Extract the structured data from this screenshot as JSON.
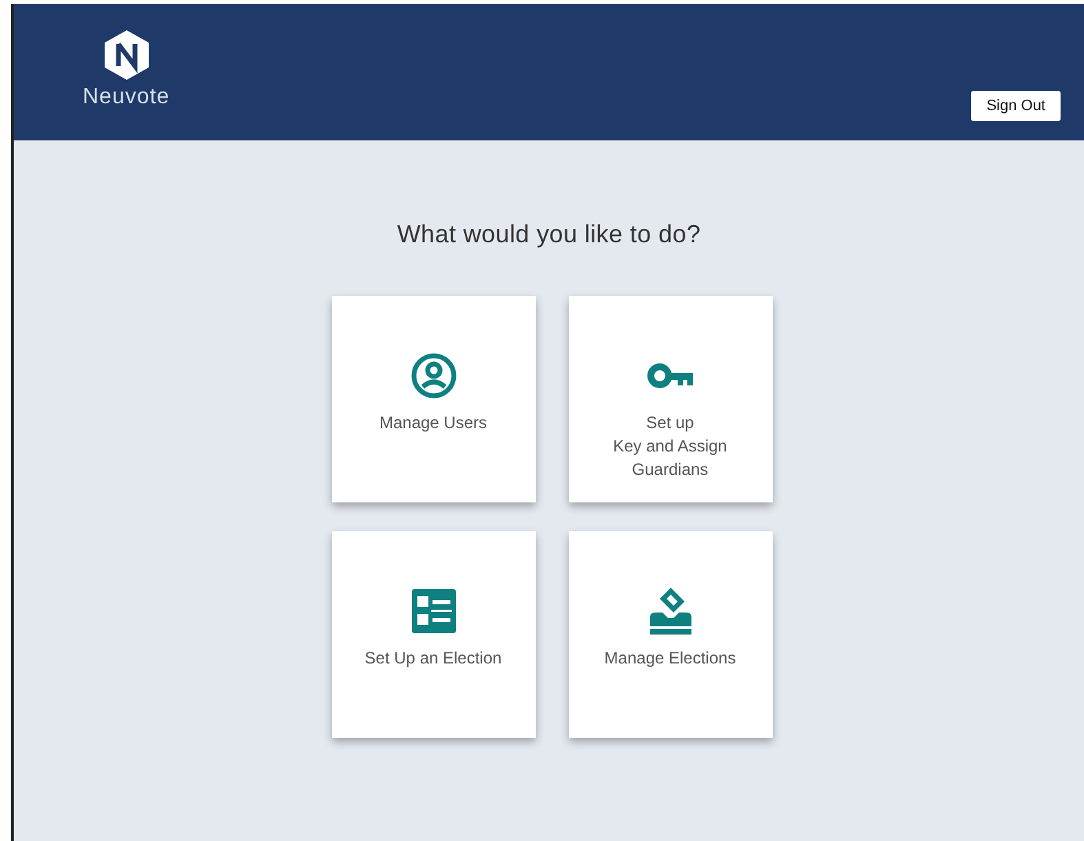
{
  "header": {
    "brand": "Neuvote",
    "sign_out": "Sign Out"
  },
  "heading": "What would you like to do?",
  "actions": [
    {
      "kind": "users",
      "label": "Manage Users"
    },
    {
      "kind": "key",
      "label": "Set up\nKey and Assign\nGuardians"
    },
    {
      "kind": "ballot",
      "label": "Set Up an Election"
    },
    {
      "kind": "vote",
      "label": "Manage Elections"
    }
  ]
}
